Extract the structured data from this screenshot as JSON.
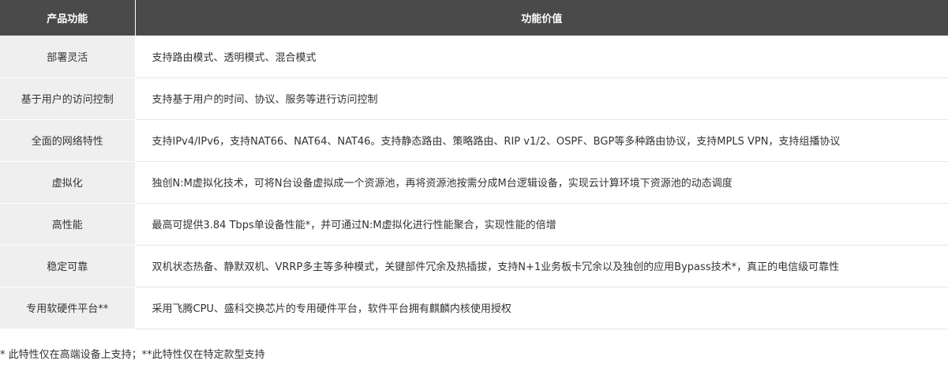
{
  "table": {
    "headers": [
      "产品功能",
      "功能价值"
    ],
    "rows": [
      {
        "feature": "部署灵活",
        "value": "支持路由模式、透明模式、混合模式"
      },
      {
        "feature": "基于用户的访问控制",
        "value": "支持基于用户的时间、协议、服务等进行访问控制"
      },
      {
        "feature": "全面的网络特性",
        "value": "支持IPv4/IPv6，支持NAT66、NAT64、NAT46。支持静态路由、策略路由、RIP v1/2、OSPF、BGP等多种路由协议，支持MPLS VPN，支持组播协议"
      },
      {
        "feature": "虚拟化",
        "value": "独创N:M虚拟化技术，可将N台设备虚拟成一个资源池，再将资源池按需分成M台逻辑设备，实现云计算环境下资源池的动态调度"
      },
      {
        "feature": "高性能",
        "value": "最高可提供3.84 Tbps单设备性能*，并可通过N:M虚拟化进行性能聚合，实现性能的倍增"
      },
      {
        "feature": "稳定可靠",
        "value": "双机状态热备、静默双机、VRRP多主等多种模式，关键部件冗余及热插拔，支持N+1业务板卡冗余以及独创的应用Bypass技术*，真正的电信级可靠性"
      },
      {
        "feature": "专用软硬件平台**",
        "value": "采用飞腾CPU、盛科交换芯片的专用硬件平台，软件平台拥有麒麟内核使用授权"
      }
    ]
  },
  "footnote": "* 此特性仅在高端设备上支持；**此特性仅在特定款型支持"
}
